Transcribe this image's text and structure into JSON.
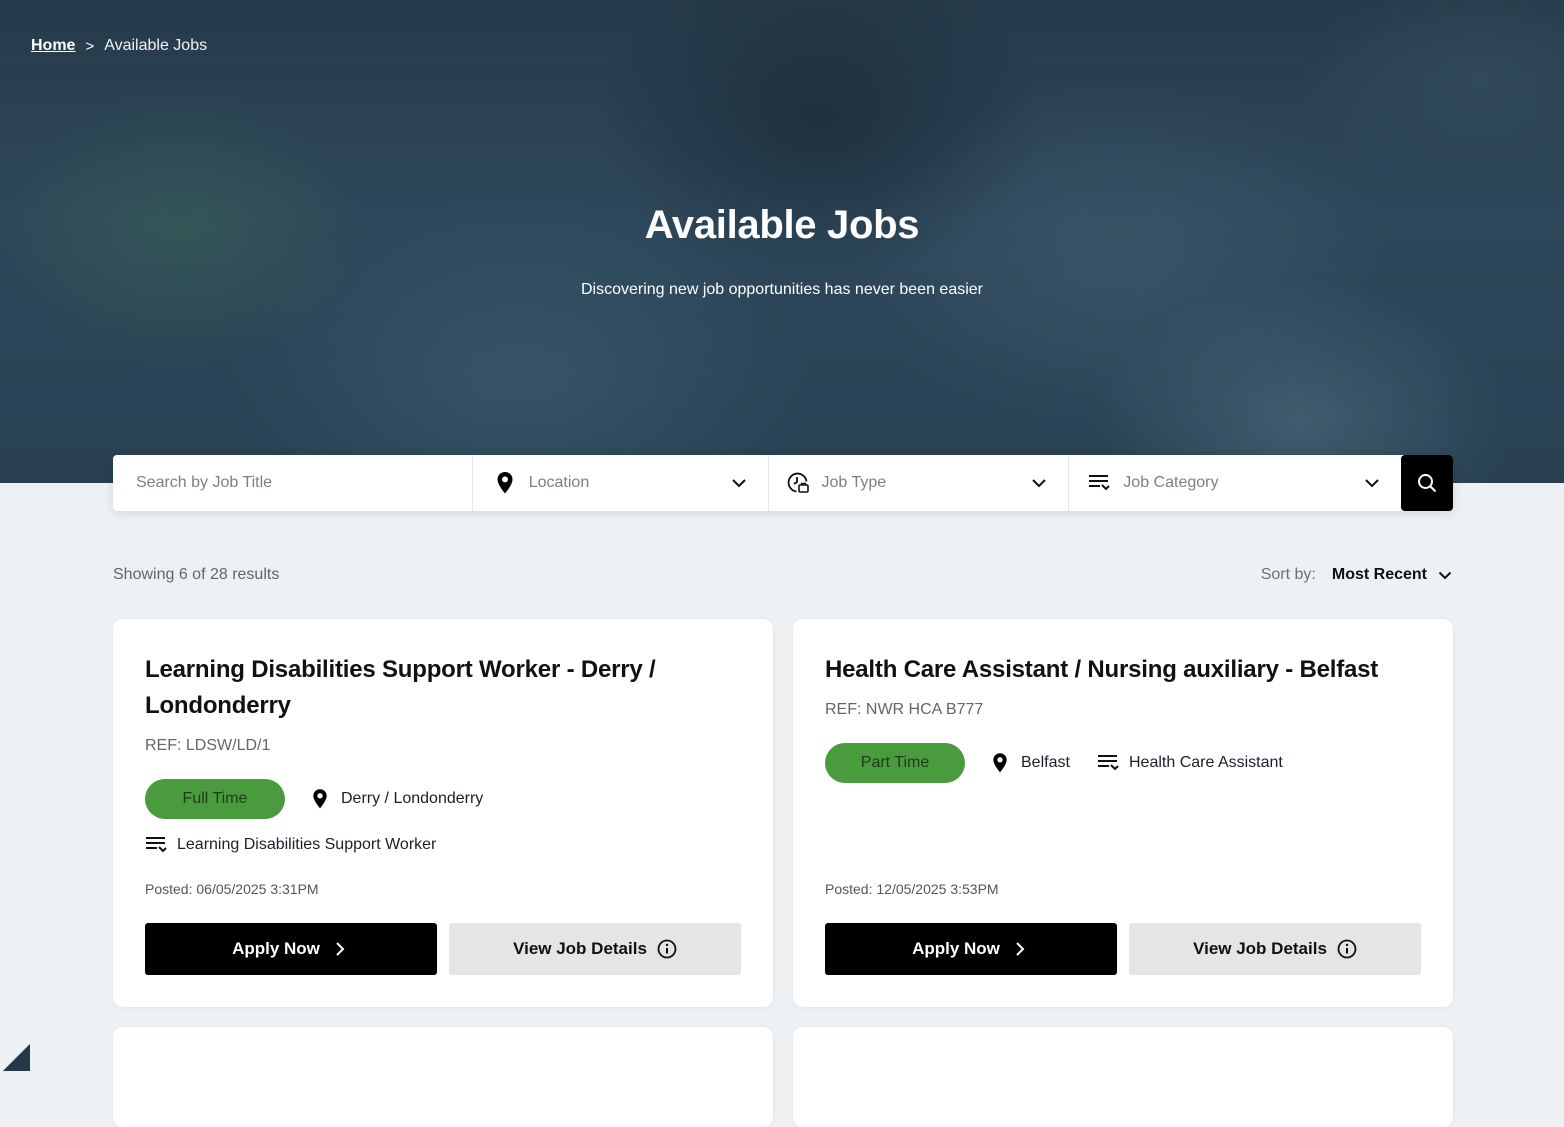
{
  "breadcrumb": {
    "home": "Home",
    "separator": ">",
    "current": "Available Jobs"
  },
  "hero": {
    "title": "Available Jobs",
    "subtitle": "Discovering new job opportunities has never been easier"
  },
  "search": {
    "title_placeholder": "Search by Job Title",
    "location_placeholder": "Location",
    "job_type_placeholder": "Job Type",
    "job_category_placeholder": "Job Category",
    "submit_icon": "search-icon"
  },
  "results": {
    "showing": "Showing 6 of 28 results",
    "sort_label": "Sort by:",
    "sort_value": "Most Recent"
  },
  "colors": {
    "pill_green": "#4a9a3e",
    "apply_bg": "#000000",
    "view_bg": "#e4e5e6"
  },
  "jobs": [
    {
      "title": "Learning Disabilities Support Worker - Derry / Londonderry",
      "ref": "REF: LDSW/LD/1",
      "type": "Full Time",
      "location": "Derry / Londonderry",
      "category": "Learning Disabilities Support Worker",
      "posted": "Posted: 06/05/2025 3:31PM",
      "apply_label": "Apply Now",
      "view_label": "View Job Details"
    },
    {
      "title": "Health Care Assistant / Nursing auxiliary - Belfast",
      "ref": "REF: NWR HCA B777",
      "type": "Part Time",
      "location": "Belfast",
      "category": "Health Care Assistant",
      "posted": "Posted: 12/05/2025 3:53PM",
      "apply_label": "Apply Now",
      "view_label": "View Job Details"
    }
  ]
}
